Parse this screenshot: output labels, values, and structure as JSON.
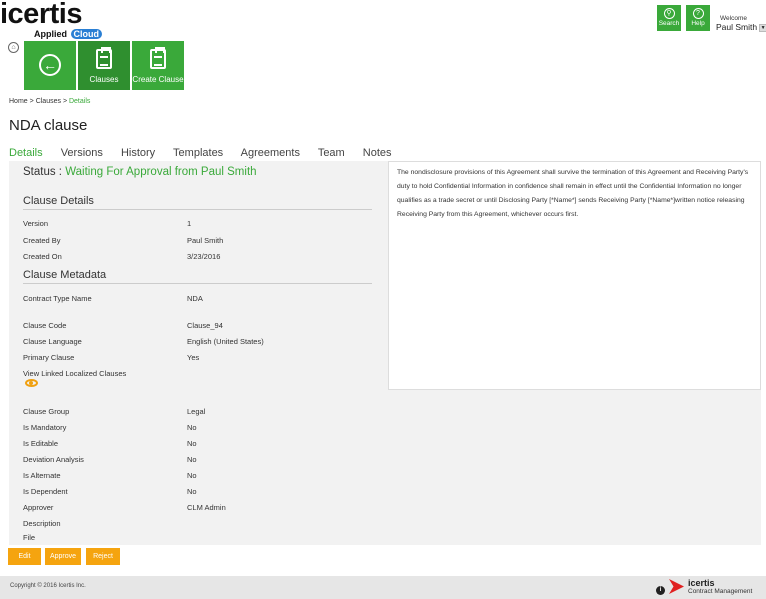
{
  "brand": {
    "name": "icertis",
    "sub_a": "Applied",
    "sub_b": "Cloud"
  },
  "header": {
    "search_label": "Search",
    "help_label": "Help",
    "welcome": "Welcome",
    "user": "Paul Smith"
  },
  "tiles": {
    "clauses": "Clauses",
    "create": "Create Clause"
  },
  "breadcrumb": {
    "home": "Home",
    "clauses": "Clauses",
    "current": "Details",
    "sep": ">"
  },
  "page_title": "NDA clause",
  "tabs": [
    "Details",
    "Versions",
    "History",
    "Templates",
    "Agreements",
    "Team",
    "Notes"
  ],
  "status": {
    "label": "Status :",
    "value": "Waiting For Approval from",
    "person": "Paul Smith"
  },
  "sections": {
    "details": "Clause Details",
    "metadata": "Clause Metadata"
  },
  "details": [
    {
      "label": "Version",
      "value": "1"
    },
    {
      "label": "Created By",
      "value": "Paul Smith"
    },
    {
      "label": "Created On",
      "value": "3/23/2016"
    }
  ],
  "metadata": [
    {
      "label": "Contract Type Name",
      "value": "NDA"
    },
    {
      "label": "Clause Code",
      "value": "Clause_94"
    },
    {
      "label": "Clause Language",
      "value": "English (United States)"
    },
    {
      "label": "Primary Clause",
      "value": "Yes"
    },
    {
      "label": "View Linked Localized Clauses",
      "value": ""
    },
    {
      "label": "Clause Group",
      "value": "Legal"
    },
    {
      "label": "Is Mandatory",
      "value": "No"
    },
    {
      "label": "Is Editable",
      "value": "No"
    },
    {
      "label": "Deviation Analysis",
      "value": "No"
    },
    {
      "label": "Is Alternate",
      "value": "No"
    },
    {
      "label": "Is Dependent",
      "value": "No"
    },
    {
      "label": "Approver",
      "value": "CLM Admin"
    },
    {
      "label": "Description",
      "value": ""
    },
    {
      "label": "File",
      "value": ""
    }
  ],
  "clause_text": "The nondisclosure provisions of this Agreement shall survive the termination of this Agreement and Receiving Party's duty to hold Confidential Information in confidence shall remain in effect until the Confidential Information no longer qualifies as a trade secret or until Disclosing Party [*Name*] sends Receiving Party [*Name*]written notice releasing Receiving Party from this Agreement, whichever occurs first.",
  "buttons": {
    "edit": "Edit",
    "approve": "Approve",
    "reject": "Reject"
  },
  "footer": {
    "copyright": "Copyright © 2016 Icertis Inc.",
    "logo": "icertis",
    "logo_sub": "Contract Management"
  },
  "colors": {
    "accent_green": "#3aa93a",
    "action_orange": "#f5a40f"
  }
}
